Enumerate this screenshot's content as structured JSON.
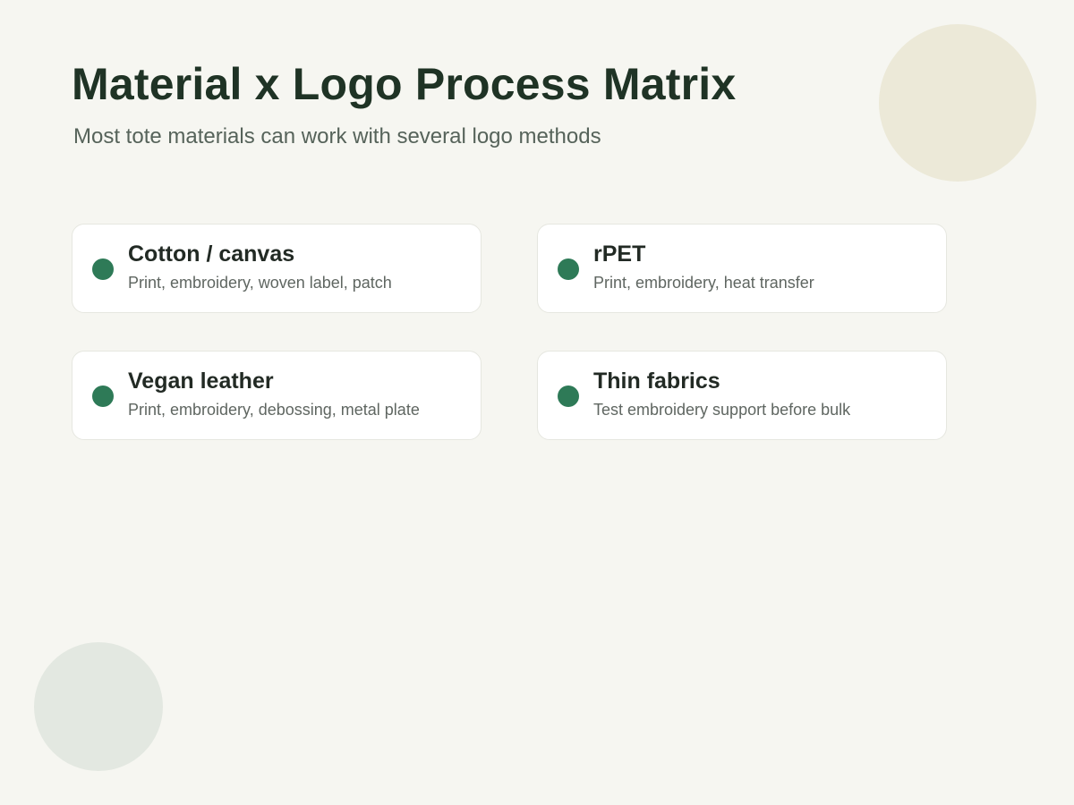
{
  "header": {
    "title": "Material x Logo Process Matrix",
    "subtitle": "Most tote materials can work with several logo methods"
  },
  "cards": [
    {
      "title": "Cotton / canvas",
      "description": "Print, embroidery, woven label, patch"
    },
    {
      "title": "rPET",
      "description": "Print, embroidery, heat transfer"
    },
    {
      "title": "Vegan leather",
      "description": "Print, embroidery, debossing, metal plate"
    },
    {
      "title": "Thin fabrics",
      "description": "Test embroidery support before bulk"
    }
  ],
  "colors": {
    "background": "#f6f6f1",
    "accent": "#2e7a57",
    "title": "#1f3325",
    "card_background": "#ffffff",
    "decor_top": "#ece9d8",
    "decor_bottom": "#e3e8e1"
  }
}
